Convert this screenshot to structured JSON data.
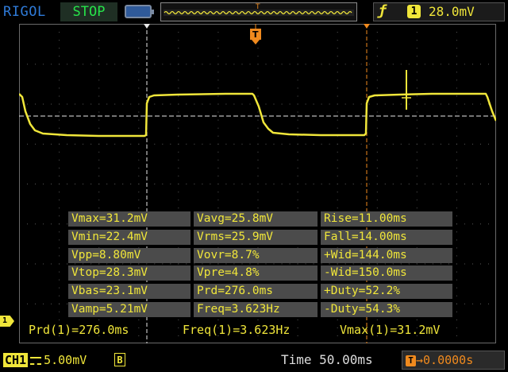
{
  "header": {
    "brand": "RIGOL",
    "run_state": "STOP",
    "trigger_marker": "T",
    "trigger_source": "1",
    "trigger_level": "28.0mV",
    "icons": [
      "battery-icon",
      "rising-edge-icon"
    ]
  },
  "screen": {
    "trigger_position_marker": "T",
    "channel_marker": "1"
  },
  "measurements": {
    "rows": [
      [
        "Vmax=31.2mV",
        "Vavg=25.8mV",
        "Rise=11.00ms"
      ],
      [
        "Vmin=22.4mV",
        "Vrms=25.9mV",
        "Fall=14.00ms"
      ],
      [
        "Vpp=8.80mV",
        "Vovr=8.7%",
        "+Wid=144.0ms"
      ],
      [
        "Vtop=28.3mV",
        "Vpre=4.8%",
        "-Wid=150.0ms"
      ],
      [
        "Vbas=23.1mV",
        "Prd=276.0ms",
        "+Duty=52.2%"
      ],
      [
        "Vamp=5.21mV",
        "Freq=3.623Hz",
        "-Duty=54.3%"
      ]
    ]
  },
  "bottom_measurements": {
    "prd": "Prd(1)=276.0ms",
    "freq": "Freq(1)=3.623Hz",
    "vmax": "Vmax(1)=31.2mV"
  },
  "footer": {
    "channel": "CH1",
    "coupling_icon": "dc-coupling-icon",
    "scale": "5.00mV",
    "bandwidth_limit": "B",
    "timebase": "Time 50.00ms",
    "trigger_offset": "0.0000s",
    "trigger_offset_icon": "T"
  },
  "colors": {
    "trace": "#f0e63a",
    "brand": "#2f7bd8",
    "stop": "#26e34a",
    "trigger": "#f08a1e"
  }
}
